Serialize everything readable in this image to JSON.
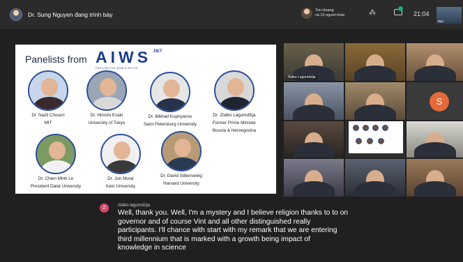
{
  "topbar": {
    "presenter_label": "Dr. Sung Nguyen đang trình bày",
    "participants_line1": "Ton Hoang",
    "participants_line2": "và 13 người khác",
    "time": "21:04",
    "self_view_label": "Bạn"
  },
  "slide": {
    "heading": "Panelists from",
    "logo_text": "AIWS",
    "logo_suffix": ".NET",
    "logo_tagline": "FOR A BETTER WORLD WITH AI",
    "panelists": [
      {
        "name": "Dr. Nazli Choucri",
        "affiliation": "MIT"
      },
      {
        "name": "Dr. Hiroshi Esaki",
        "affiliation": "University of Tokyo"
      },
      {
        "name": "Dr. Mikhail Kupriyanov",
        "affiliation": "Saint Petersburg University"
      },
      {
        "name": "Dr. Zlatko Lagumdžija",
        "affiliation": "Former Prime Minister",
        "affiliation2": "Bosnia & Herzegovina"
      },
      {
        "name": "Dr. Chien Minh Le",
        "affiliation": "President Dalat University"
      },
      {
        "name": "Dr. Jun Murai",
        "affiliation": "Keio University"
      },
      {
        "name": "Dr. David Silbersweig",
        "affiliation": "Harvard University"
      }
    ]
  },
  "video_grid": {
    "tile1_name": "Zlatko Lagumdzija",
    "initial": "S"
  },
  "caption": {
    "avatar_initial": "Z",
    "speaker": "zlatko lagumdzija",
    "lines": [
      "Well, thank you. Well, I'm a mystery and I believe religion thanks to to on",
      "governor and of course Vint and all other distinguished really",
      "participants. I'll chance with start with my remark that we are entering",
      "third millennium that is marked with a growth being impact of",
      "knowledge in science"
    ]
  },
  "colors": {
    "accent_blue": "#2c4f9e",
    "caption_avatar": "#d9486e",
    "initial_avatar": "#e46a3a"
  }
}
